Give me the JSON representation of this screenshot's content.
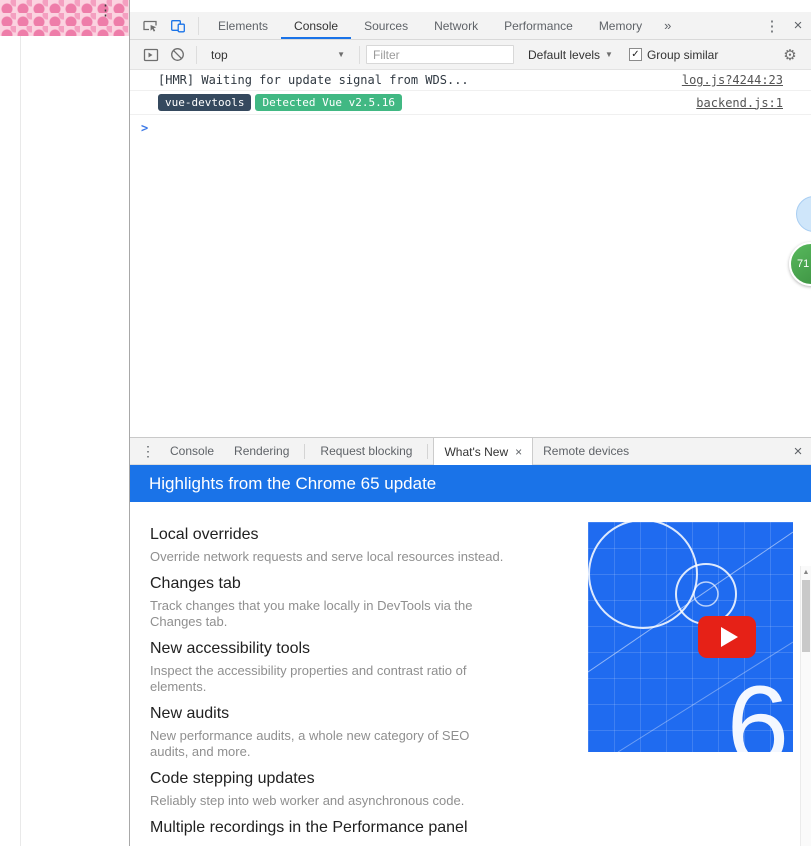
{
  "page_strip": {
    "menu_icon": "⋮"
  },
  "toolbar": {
    "tabs": [
      "Elements",
      "Console",
      "Sources",
      "Network",
      "Performance",
      "Memory"
    ],
    "active_tab": "Console",
    "more_tabs": "»",
    "menu_icon": "⋮",
    "close_icon": "×"
  },
  "console_toolbar": {
    "context": "top",
    "dropdown_arrow": "▼",
    "filter_placeholder": "Filter",
    "levels": "Default levels",
    "group_similar": "Group similar",
    "checkbox_check": "✓",
    "gear_icon": "⚙"
  },
  "console": {
    "hmr_message": "[HMR] Waiting for update signal from WDS...",
    "hmr_source": "log.js?4244:23",
    "vue_badge": "vue-devtools",
    "vue_detected_badge": "Detected Vue v2.5.16",
    "vue_source": "backend.js:1",
    "prompt": ">"
  },
  "overlays": {
    "counter": "71"
  },
  "drawer": {
    "menu_icon": "⋮",
    "close_icon": "×",
    "tabs": [
      "Console",
      "Rendering",
      "Request blocking",
      "What's New",
      "Remote devices"
    ],
    "active_tab": "What's New",
    "tab_close": "×"
  },
  "whats_new": {
    "header": "Highlights from the Chrome 65 update",
    "sections": [
      {
        "title": "Local overrides",
        "body": "Override network requests and serve local resources instead."
      },
      {
        "title": "Changes tab",
        "body": "Track changes that you make locally in DevTools via the Changes tab."
      },
      {
        "title": "New accessibility tools",
        "body": "Inspect the accessibility properties and contrast ratio of elements."
      },
      {
        "title": "New audits",
        "body": "New performance audits, a whole new category of SEO audits, and more."
      },
      {
        "title": "Code stepping updates",
        "body": "Reliably step into web worker and asynchronous code."
      },
      {
        "title": "Multiple recordings in the Performance panel",
        "body": ""
      }
    ],
    "video_digit": "6",
    "scroll_up_icon": "▲",
    "colors": {
      "header_blue": "#1a73e8",
      "thumbnail_blue": "#1f6bf0",
      "play_red": "#e62117",
      "vue_green": "#41b883",
      "vue_dark": "#35495e"
    }
  }
}
